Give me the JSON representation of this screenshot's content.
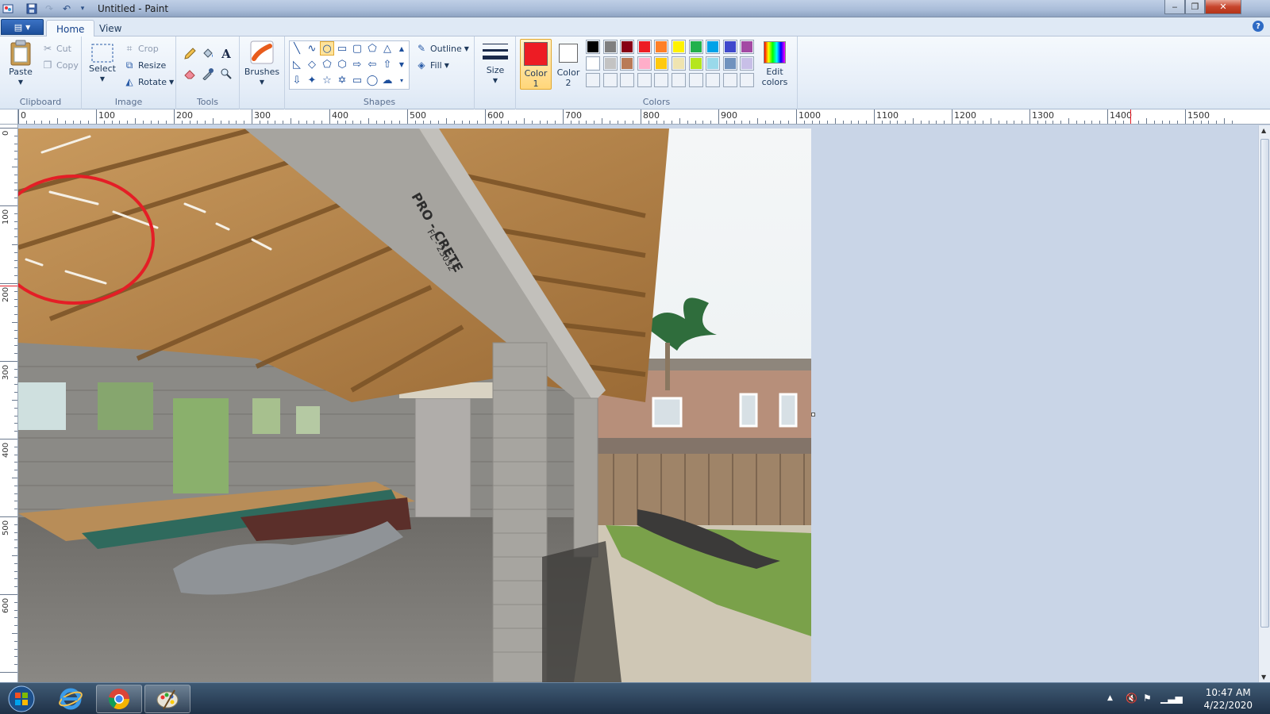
{
  "window": {
    "title": "Untitled - Paint",
    "minimize": "‒",
    "maximize": "❐",
    "close": "✕"
  },
  "quick_access": {
    "save_icon": "floppy-disk-icon",
    "undo_icon": "undo-icon",
    "redo_icon": "redo-icon"
  },
  "tabs": {
    "file_menu_icon": "paint-menu-icon",
    "items": [
      "Home",
      "View"
    ],
    "active": "Home"
  },
  "ribbon": {
    "clipboard": {
      "label": "Clipboard",
      "paste": "Paste",
      "cut": "Cut",
      "copy": "Copy"
    },
    "image": {
      "label": "Image",
      "select": "Select",
      "crop": "Crop",
      "resize": "Resize",
      "rotate": "Rotate"
    },
    "tools": {
      "label": "Tools"
    },
    "brushes": {
      "label": "Brushes"
    },
    "shapes": {
      "label": "Shapes",
      "outline": "Outline",
      "fill": "Fill",
      "selected_shape": "oval"
    },
    "size": {
      "label": "Size"
    },
    "colors": {
      "label": "Colors",
      "color1_label": "Color",
      "color1_num": "1",
      "color2_label": "Color",
      "color2_num": "2",
      "color1": "#ed1c24",
      "color2": "#ffffff",
      "edit_colors": "Edit colors",
      "palette_row1": [
        "#000000",
        "#7f7f7f",
        "#880015",
        "#ed1c24",
        "#ff7f27",
        "#fff200",
        "#22b14c",
        "#00a2e8",
        "#3f48cc",
        "#a349a4"
      ],
      "palette_row2": [
        "#ffffff",
        "#c3c3c3",
        "#b97a57",
        "#ffaec9",
        "#ffc90e",
        "#efe4b0",
        "#b5e61d",
        "#99d9ea",
        "#7092be",
        "#c8bfe7"
      ],
      "palette_row3": [
        "#ffffff",
        "#ffffff",
        "#ffffff",
        "#ffffff",
        "#ffffff",
        "#ffffff",
        "#ffffff",
        "#ffffff",
        "#ffffff",
        "#ffffff"
      ]
    }
  },
  "rulers": {
    "h_labels": [
      "0",
      "100",
      "200",
      "300",
      "400",
      "500",
      "600",
      "700",
      "800",
      "900",
      "1000",
      "1100",
      "1200",
      "1300",
      "1400",
      "1500"
    ],
    "v_labels": [
      "0",
      "100",
      "200",
      "300",
      "400",
      "500",
      "600"
    ]
  },
  "canvas": {
    "stamp_line1": "PRO - CRETE",
    "stamp_line2": "FL - 23032"
  },
  "taskbar": {
    "apps": [
      "start-orb-icon",
      "internet-explorer-icon",
      "chrome-icon",
      "paint-icon"
    ],
    "time": "10:47 AM",
    "date": "4/22/2020"
  }
}
